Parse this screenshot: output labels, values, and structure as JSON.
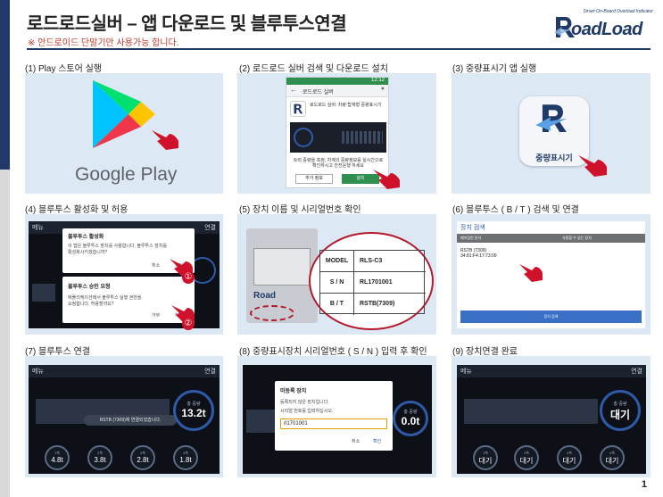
{
  "header": {
    "title": "로드로드실버 – 앱 다운로드 및 블루투스연결",
    "subtitle": "※ 안드로이드 단말기만 사용가능 합니다.",
    "logo_tag": "Smart On-Board Overload Indicator",
    "logo_text": "oadLoad",
    "page_number": "1"
  },
  "panels": [
    {
      "label": "(1) Play 스토어 실행"
    },
    {
      "label": "(2) 로드로드 실버 검색 및 다운로드 설치"
    },
    {
      "label": "(3) 중량표시기 앱 실행"
    },
    {
      "label": "(4) 블루투스 활성화 및 허용"
    },
    {
      "label": "(5) 장치 이름 및 시리얼번호 확인"
    },
    {
      "label": "(6) 블루투스 ( B / T ) 검색 및 연결"
    },
    {
      "label": "(7) 블루투스 연결"
    },
    {
      "label": "(8) 중량표시장치 시리얼번호 ( S / N ) 입력 후 확인"
    },
    {
      "label": "(9) 장치연결 완료"
    }
  ],
  "p1": {
    "store_name": "Google Play"
  },
  "p2": {
    "status_time": "12:12",
    "search_text": "로드로드 실버",
    "app_name": "로드로드 실버: 차량 탑재형 중량표시기",
    "desc1": "트럭 중량을 측정, 차계의 중량정보를 실시간으로",
    "desc2": "확인하시고 안전운행 하세요",
    "more_button": "추가 정보",
    "install_button": "설치"
  },
  "p3": {
    "app_label": "중량표시기"
  },
  "p4": {
    "menu": "메뉴",
    "connect": "연결",
    "dialog1_title": "블루투스 활성화",
    "dialog1_body1": "이 앱은 블루투스 장치를 사용합니다. 블루투스 장치를",
    "dialog1_body2": "활성화시키겠습니까?",
    "dialog1_cancel": "취소",
    "dialog1_ok": "확인",
    "dialog2_title": "블루투스 승인 요청",
    "dialog2_body1": "애플리케이션에서 블루투스 실행 권한을",
    "dialog2_body2": "요청합니다. 허용할까요?",
    "dialog2_deny": "거부",
    "dialog2_allow": "허용",
    "marker1": "①",
    "marker2": "②"
  },
  "p5": {
    "model_key": "MODEL",
    "model_val": "RLS-C3",
    "sn_key": "S / N",
    "sn_val": "RL1701001",
    "bt_key": "B / T",
    "bt_val": "RSTB(7309)",
    "brand_text": "Road"
  },
  "p6": {
    "header": "장치 검색",
    "col_left": "페어링된 장치",
    "col_right": "사용할 수 있는 장치",
    "device_name": "RSTB (7309)",
    "device_mac": "34:81:F4:17:73:09",
    "scan_button": "장치 검색"
  },
  "p7": {
    "menu": "메뉴",
    "connect": "연결",
    "status_msg": "RSTB (7309)에 연결되었습니다.",
    "gauge_label": "총 중량",
    "gauge_value": "13.2t",
    "axles": [
      {
        "label": "1축",
        "value": "4.8t"
      },
      {
        "label": "2축",
        "value": "3.8t"
      },
      {
        "label": "3축",
        "value": "2.8t"
      },
      {
        "label": "4축",
        "value": "1.8t"
      }
    ]
  },
  "p8": {
    "dialog_title": "미등록 장치",
    "body1": "등록되지 않은 장치입니다.",
    "body2": "시리얼 번호를 입력하십시오.",
    "input_value": "rl1701001",
    "cancel": "취소",
    "ok": "확인",
    "gauge_label": "총 중량",
    "gauge_value": "0.0t"
  },
  "p9": {
    "menu": "메뉴",
    "connect": "연결",
    "gauge_label": "총 중량",
    "gauge_value": "대기",
    "axles": [
      {
        "label": "1축",
        "value": "대기"
      },
      {
        "label": "2축",
        "value": "대기"
      },
      {
        "label": "3축",
        "value": "대기"
      },
      {
        "label": "4축",
        "value": "대기"
      }
    ]
  },
  "colors": {
    "navy": "#1f3a66",
    "panel_bg": "#dde8f5",
    "accent_red": "#c0392b",
    "hand_red": "#d0112b",
    "gauge_blue": "#2e5aa8"
  }
}
